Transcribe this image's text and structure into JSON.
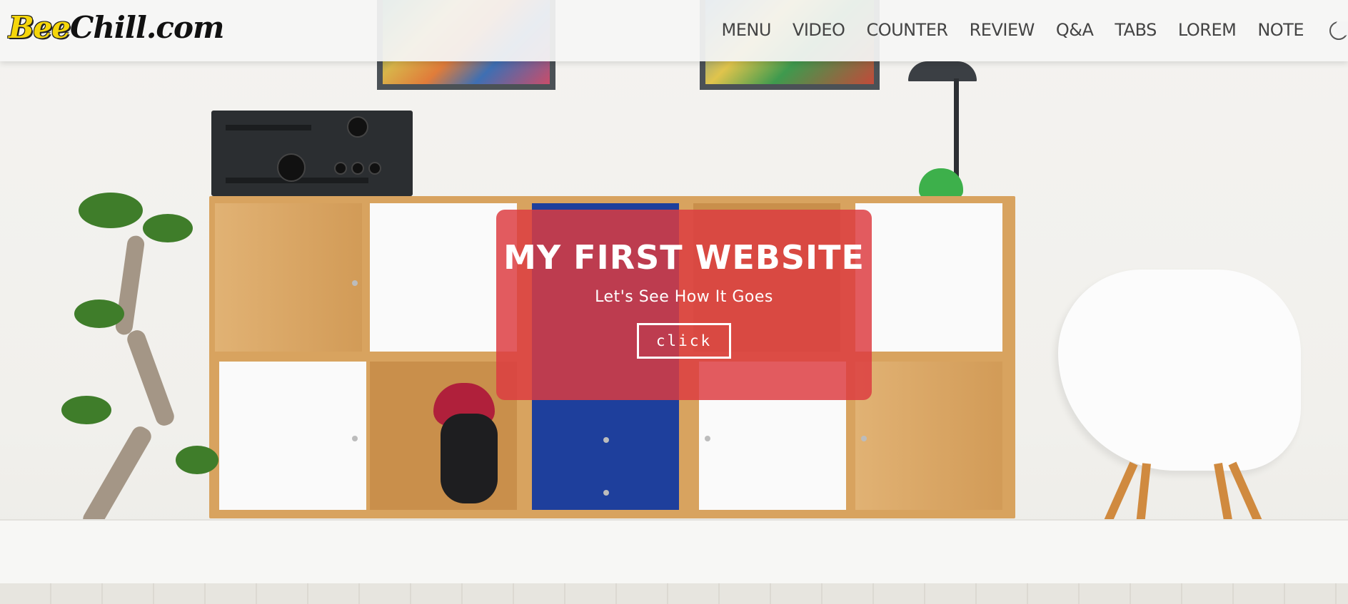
{
  "brand": {
    "logo_part1": "Bee",
    "logo_part2": "Chill.com",
    "logo_part1_color": "#f5d60a",
    "logo_part2_color": "#111111"
  },
  "nav": {
    "items": [
      {
        "label": "MENU"
      },
      {
        "label": "VIDEO"
      },
      {
        "label": "COUNTER"
      },
      {
        "label": "REVIEW"
      },
      {
        "label": "Q&A"
      },
      {
        "label": "TABS"
      },
      {
        "label": "LOREM"
      },
      {
        "label": "NOTE"
      }
    ],
    "theme_toggle_icon": "moon-icon"
  },
  "hero": {
    "title": "MY FIRST WEBSITE",
    "subtitle": "Let's See How It Goes",
    "button_label": "click",
    "card_color": "#dc3c40"
  }
}
